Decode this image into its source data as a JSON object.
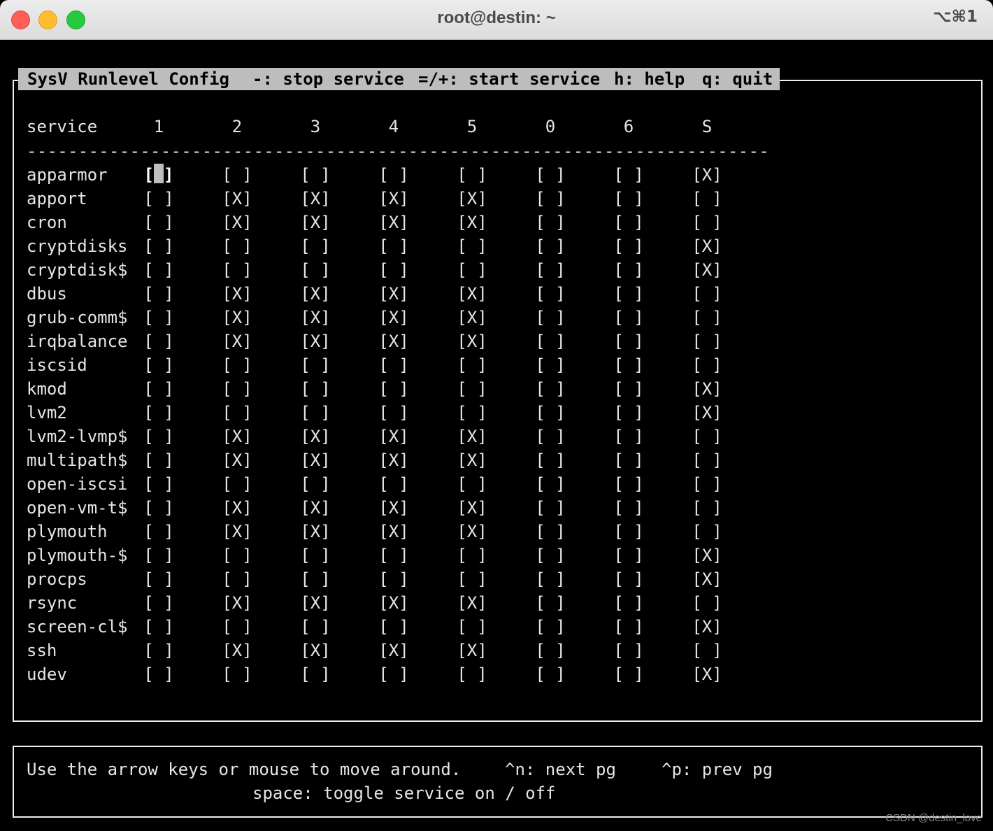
{
  "window": {
    "title": "root@destin: ~",
    "shortcut": "⌥⌘1"
  },
  "header": {
    "app_name": "SysV Runlevel Config",
    "stop_hint": "-: stop service",
    "start_hint": "=/+: start service",
    "help_hint": "h: help",
    "quit_hint": "q: quit"
  },
  "table": {
    "service_header": "service",
    "runlevels": [
      "1",
      "2",
      "3",
      "4",
      "5",
      "0",
      "6",
      "S"
    ],
    "separator": "------------------------------------------------------------------------------",
    "on_mark": "[X]",
    "off_mark": "[ ]",
    "cursor": {
      "row": 0,
      "col": 0
    },
    "rows": [
      {
        "name": "apparmor",
        "states": [
          0,
          0,
          0,
          0,
          0,
          0,
          0,
          1
        ]
      },
      {
        "name": "apport",
        "states": [
          0,
          1,
          1,
          1,
          1,
          0,
          0,
          0
        ]
      },
      {
        "name": "cron",
        "states": [
          0,
          1,
          1,
          1,
          1,
          0,
          0,
          0
        ]
      },
      {
        "name": "cryptdisks",
        "states": [
          0,
          0,
          0,
          0,
          0,
          0,
          0,
          1
        ]
      },
      {
        "name": "cryptdisk$",
        "states": [
          0,
          0,
          0,
          0,
          0,
          0,
          0,
          1
        ]
      },
      {
        "name": "dbus",
        "states": [
          0,
          1,
          1,
          1,
          1,
          0,
          0,
          0
        ]
      },
      {
        "name": "grub-comm$",
        "states": [
          0,
          1,
          1,
          1,
          1,
          0,
          0,
          0
        ]
      },
      {
        "name": "irqbalance",
        "states": [
          0,
          1,
          1,
          1,
          1,
          0,
          0,
          0
        ]
      },
      {
        "name": "iscsid",
        "states": [
          0,
          0,
          0,
          0,
          0,
          0,
          0,
          0
        ]
      },
      {
        "name": "kmod",
        "states": [
          0,
          0,
          0,
          0,
          0,
          0,
          0,
          1
        ]
      },
      {
        "name": "lvm2",
        "states": [
          0,
          0,
          0,
          0,
          0,
          0,
          0,
          1
        ]
      },
      {
        "name": "lvm2-lvmp$",
        "states": [
          0,
          1,
          1,
          1,
          1,
          0,
          0,
          0
        ]
      },
      {
        "name": "multipath$",
        "states": [
          0,
          1,
          1,
          1,
          1,
          0,
          0,
          0
        ]
      },
      {
        "name": "open-iscsi",
        "states": [
          0,
          0,
          0,
          0,
          0,
          0,
          0,
          0
        ]
      },
      {
        "name": "open-vm-t$",
        "states": [
          0,
          1,
          1,
          1,
          1,
          0,
          0,
          0
        ]
      },
      {
        "name": "plymouth",
        "states": [
          0,
          1,
          1,
          1,
          1,
          0,
          0,
          0
        ]
      },
      {
        "name": "plymouth-$",
        "states": [
          0,
          0,
          0,
          0,
          0,
          0,
          0,
          1
        ]
      },
      {
        "name": "procps",
        "states": [
          0,
          0,
          0,
          0,
          0,
          0,
          0,
          1
        ]
      },
      {
        "name": "rsync",
        "states": [
          0,
          1,
          1,
          1,
          1,
          0,
          0,
          0
        ]
      },
      {
        "name": "screen-cl$",
        "states": [
          0,
          0,
          0,
          0,
          0,
          0,
          0,
          1
        ]
      },
      {
        "name": "ssh",
        "states": [
          0,
          1,
          1,
          1,
          1,
          0,
          0,
          0
        ]
      },
      {
        "name": "udev",
        "states": [
          0,
          0,
          0,
          0,
          0,
          0,
          0,
          1
        ]
      }
    ]
  },
  "footer": {
    "move_hint": "Use the arrow keys or mouse to move around.",
    "next_hint": "^n: next pg",
    "prev_hint": "^p: prev pg",
    "toggle_hint": "space: toggle service on / off"
  },
  "watermark": "CSDN @destin_love"
}
